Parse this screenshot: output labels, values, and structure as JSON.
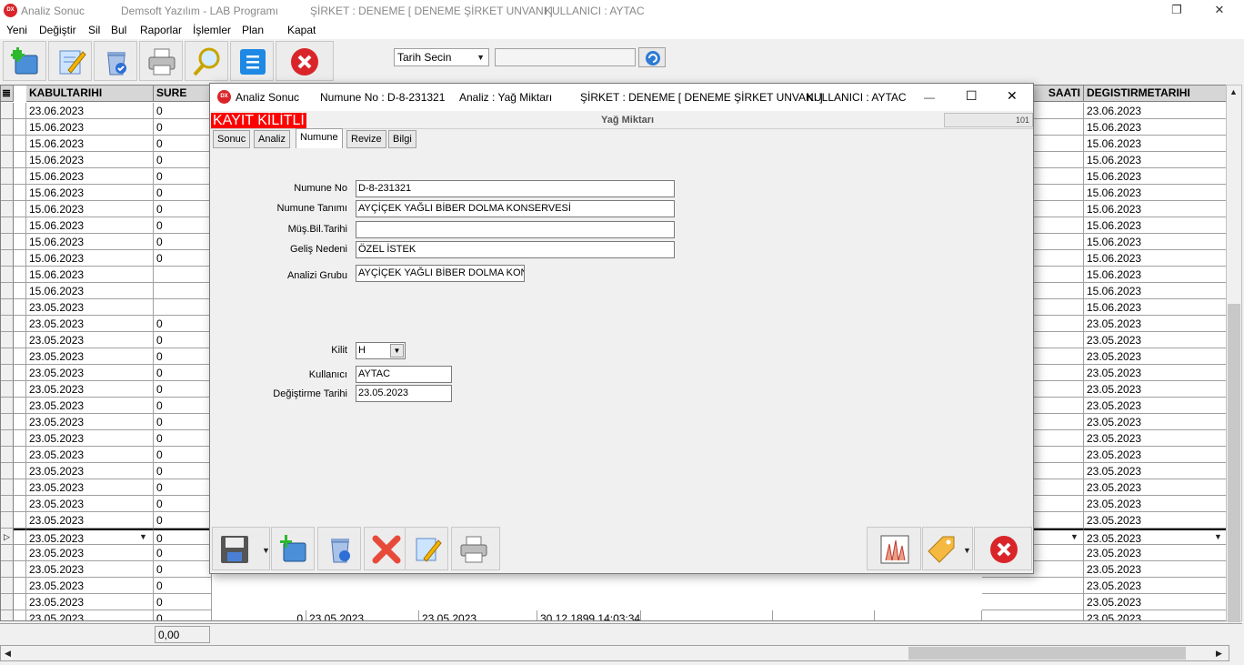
{
  "app": {
    "title": "Analiz Sonuc",
    "vendor": "Demsoft Yazılım - LAB Programı",
    "company": "ŞİRKET : DENEME [ DENEME ŞİRKET UNVANI ]",
    "user": "KULLANICI : AYTAC",
    "logo": "DX"
  },
  "menu": [
    "Yeni",
    "Değiştir",
    "Sil",
    "Bul",
    "Raporlar",
    "İşlemler",
    "Plan",
    "Kapat"
  ],
  "toolbar": {
    "icons": [
      "new-folder-icon",
      "edit-icon",
      "delete-bin-icon",
      "print-icon",
      "search-icon",
      "list-icon",
      "close-icon"
    ],
    "date_combo": "Tarih Secin",
    "date_value": ""
  },
  "grid": {
    "headers": {
      "kabul": "KABULTARIHI",
      "sure": "SURE",
      "saati": "SAATI",
      "degis": "DEGISTIRMETARIHI"
    },
    "kabul": [
      "23.06.2023",
      "15.06.2023",
      "15.06.2023",
      "15.06.2023",
      "15.06.2023",
      "15.06.2023",
      "15.06.2023",
      "15.06.2023",
      "15.06.2023",
      "15.06.2023",
      "15.06.2023",
      "15.06.2023",
      "23.05.2023",
      "23.05.2023",
      "23.05.2023",
      "23.05.2023",
      "23.05.2023",
      "23.05.2023",
      "23.05.2023",
      "23.05.2023",
      "23.05.2023",
      "23.05.2023",
      "23.05.2023",
      "23.05.2023",
      "23.05.2023",
      "23.05.2023",
      "23.05.2023",
      "23.05.2023",
      "23.05.2023",
      "23.05.2023",
      "23.05.2023"
    ],
    "sure": [
      "0",
      "0",
      "0",
      "0",
      "0",
      "0",
      "0",
      "0",
      "0",
      "0",
      "",
      "",
      "",
      "0",
      "0",
      "0",
      "0",
      "0",
      "0",
      "0",
      "0",
      "0",
      "0",
      "0",
      "0",
      "0",
      "0",
      "0",
      "0",
      "0",
      "0"
    ],
    "degis": [
      "23.06.2023",
      "15.06.2023",
      "15.06.2023",
      "15.06.2023",
      "15.06.2023",
      "15.06.2023",
      "15.06.2023",
      "15.06.2023",
      "15.06.2023",
      "15.06.2023",
      "15.06.2023",
      "15.06.2023",
      "15.06.2023",
      "23.05.2023",
      "23.05.2023",
      "23.05.2023",
      "23.05.2023",
      "23.05.2023",
      "23.05.2023",
      "23.05.2023",
      "23.05.2023",
      "23.05.2023",
      "23.05.2023",
      "23.05.2023",
      "23.05.2023",
      "23.05.2023",
      "23.05.2023",
      "23.05.2023",
      "23.05.2023",
      "23.05.2023",
      "23.05.2023"
    ],
    "extra_rows": [
      {
        "num": "0",
        "d1": "23.05.2023",
        "d2": "23.05.2023",
        "ts": "30.12.1899 14:03:34"
      },
      {
        "num": "0",
        "d1": "23.05.2023",
        "d2": "23.05.2023",
        "ts": "30.12.1899 14:03:34"
      }
    ],
    "footer_total": "0,00"
  },
  "dialog": {
    "title": "Analiz Sonuc",
    "numune": "Numune No : D-8-231321",
    "analiz": "Analiz : Yağ Miktarı",
    "company": "ŞİRKET : DENEME [ DENEME ŞİRKET UNVANI ]",
    "user": "KULLANICI : AYTAC",
    "lock_banner": "KAYIT KİLİTLİ",
    "section": "Yağ Miktarı",
    "code": "101",
    "tabs": [
      "Sonuc",
      "Analiz",
      "Numune",
      "Revize",
      "Bilgi"
    ],
    "fields": {
      "numune_no": {
        "label": "Numune No",
        "value": "D-8-231321"
      },
      "numune_tanimi": {
        "label": "Numune Tanımı",
        "value": "AYÇİÇEK YAĞLI BİBER DOLMA KONSERVESİ"
      },
      "mus_bil_tarihi": {
        "label": "Müş.Bil.Tarihi",
        "value": ""
      },
      "gelis_nedeni": {
        "label": "Geliş Nedeni",
        "value": "ÖZEL İSTEK"
      },
      "analiz_grubu": {
        "label": "Analizi Grubu",
        "value": "AYÇİÇEK YAĞLI BİBER DOLMA KON"
      },
      "kilit": {
        "label": "Kilit",
        "value": "H"
      },
      "kullanici": {
        "label": "Kullanıcı",
        "value": "AYTAC"
      },
      "degistirme_tarihi": {
        "label": "Değiştirme Tarihi",
        "value": "23.05.2023"
      }
    },
    "buttons": [
      "save-icon",
      "new-folder-icon",
      "delete-bin-icon",
      "cancel-x-icon",
      "edit-icon",
      "print-icon",
      "chart-icon",
      "tag-icon",
      "close-icon"
    ]
  },
  "colors": {
    "lock_banner": "#ff0000",
    "close_red": "#d9252a",
    "list_blue": "#1e88e5"
  }
}
